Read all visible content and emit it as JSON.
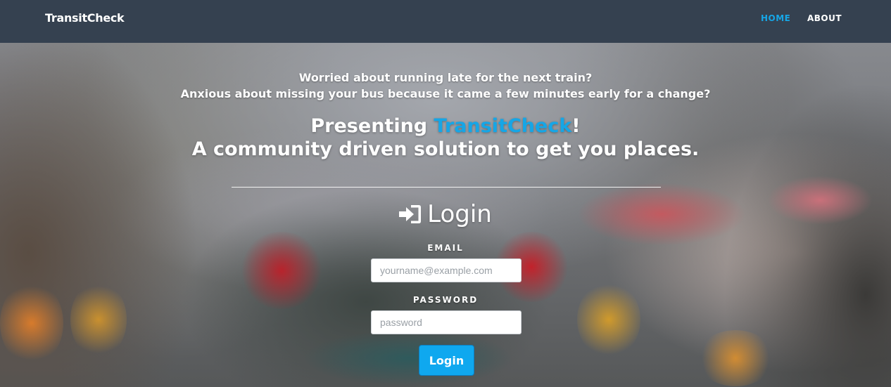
{
  "navbar": {
    "brand": "TransitCheck",
    "links": [
      {
        "label": "HOME",
        "active": true
      },
      {
        "label": "ABOUT",
        "active": false
      }
    ]
  },
  "hero": {
    "tagline_line1": "Worried about running late for the next train?",
    "tagline_line2": "Anxious about missing your bus because it came a few minutes early for a change?",
    "headline_prefix": "Presenting ",
    "headline_brand": "TransitCheck",
    "headline_suffix": "!",
    "headline_line2": "A community driven solution to get you places."
  },
  "login": {
    "title": "Login",
    "icon": "sign-in-icon",
    "email_label": "EMAIL",
    "email_placeholder": "yourname@example.com",
    "email_value": "",
    "password_label": "PASSWORD",
    "password_placeholder": "password",
    "password_value": "",
    "submit_label": "Login"
  },
  "colors": {
    "navbar_bg": "#354150",
    "accent": "#16a6e6",
    "button_bg": "#0fa8ef",
    "text": "#ffffff"
  }
}
